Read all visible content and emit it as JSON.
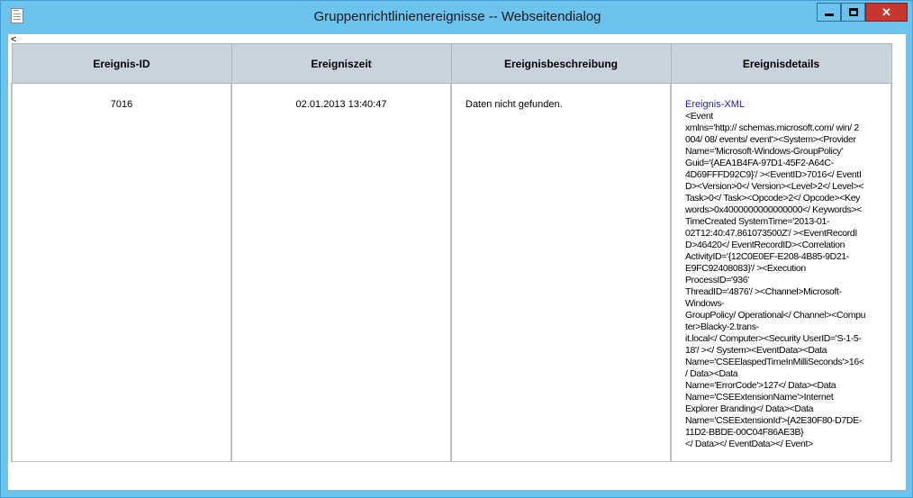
{
  "window": {
    "title": "Gruppenrichtlinienereignisse -- Webseitendialog",
    "back_glyph": "<",
    "buttons": {
      "minimize": "minimize-icon",
      "maximize": "maximize-icon",
      "close": "close-icon"
    }
  },
  "table": {
    "headers": [
      "Ereignis-ID",
      "Ereigniszeit",
      "Ereignisbeschreibung",
      "Ereignisdetails"
    ],
    "rows": [
      {
        "id": "7016",
        "time": "02.01.2013 13:40:47",
        "description": "Daten nicht gefunden.",
        "details_link": "Ereignis-XML",
        "details_xml": "<Event\nxmlns='http:// schemas.microsoft.com/ win/ 2\n004/ 08/ events/ event'><System><Provider\nName='Microsoft-Windows-GroupPolicy'\nGuid='{AEA1B4FA-97D1-45F2-A64C-\n4D69FFFD92C9}'/ ><EventID>7016</ EventI\nD><Version>0</ Version><Level>2</ Level><\nTask>0</ Task><Opcode>2</ Opcode><Key\nwords>0x4000000000000000</ Keywords><\nTimeCreated SystemTime='2013-01-\n02T12:40:47.861073500Z'/ ><EventRecordI\nD>46420</ EventRecordID><Correlation\nActivityID='{12C0E0EF-E208-4B85-9D21-\nE9FC92408083}'/ ><Execution\nProcessID='936'\nThreadID='4876'/ ><Channel>Microsoft-\nWindows-\nGroupPolicy/ Operational</ Channel><Compu\nter>Blacky-2.trans-\nit.local</ Computer><Security UserID='S-1-5-\n18'/ ></ System><EventData><Data\nName='CSEElaspedTimeInMilliSeconds'>16<\n/ Data><Data\nName='ErrorCode'>127</ Data><Data\nName='CSEExtensionName'>Internet\nExplorer Branding</ Data><Data\nName='CSEExtensionId'>{A2E30F80-D7DE-\n11D2-BBDE-00C04F86AE3B}\n</ Data></ EventData></ Event>"
      }
    ]
  },
  "colors": {
    "titlebar": "#6bc3ee",
    "close_button": "#c7372f",
    "header_bg": "#c9d3de",
    "link": "#1a1adc"
  }
}
